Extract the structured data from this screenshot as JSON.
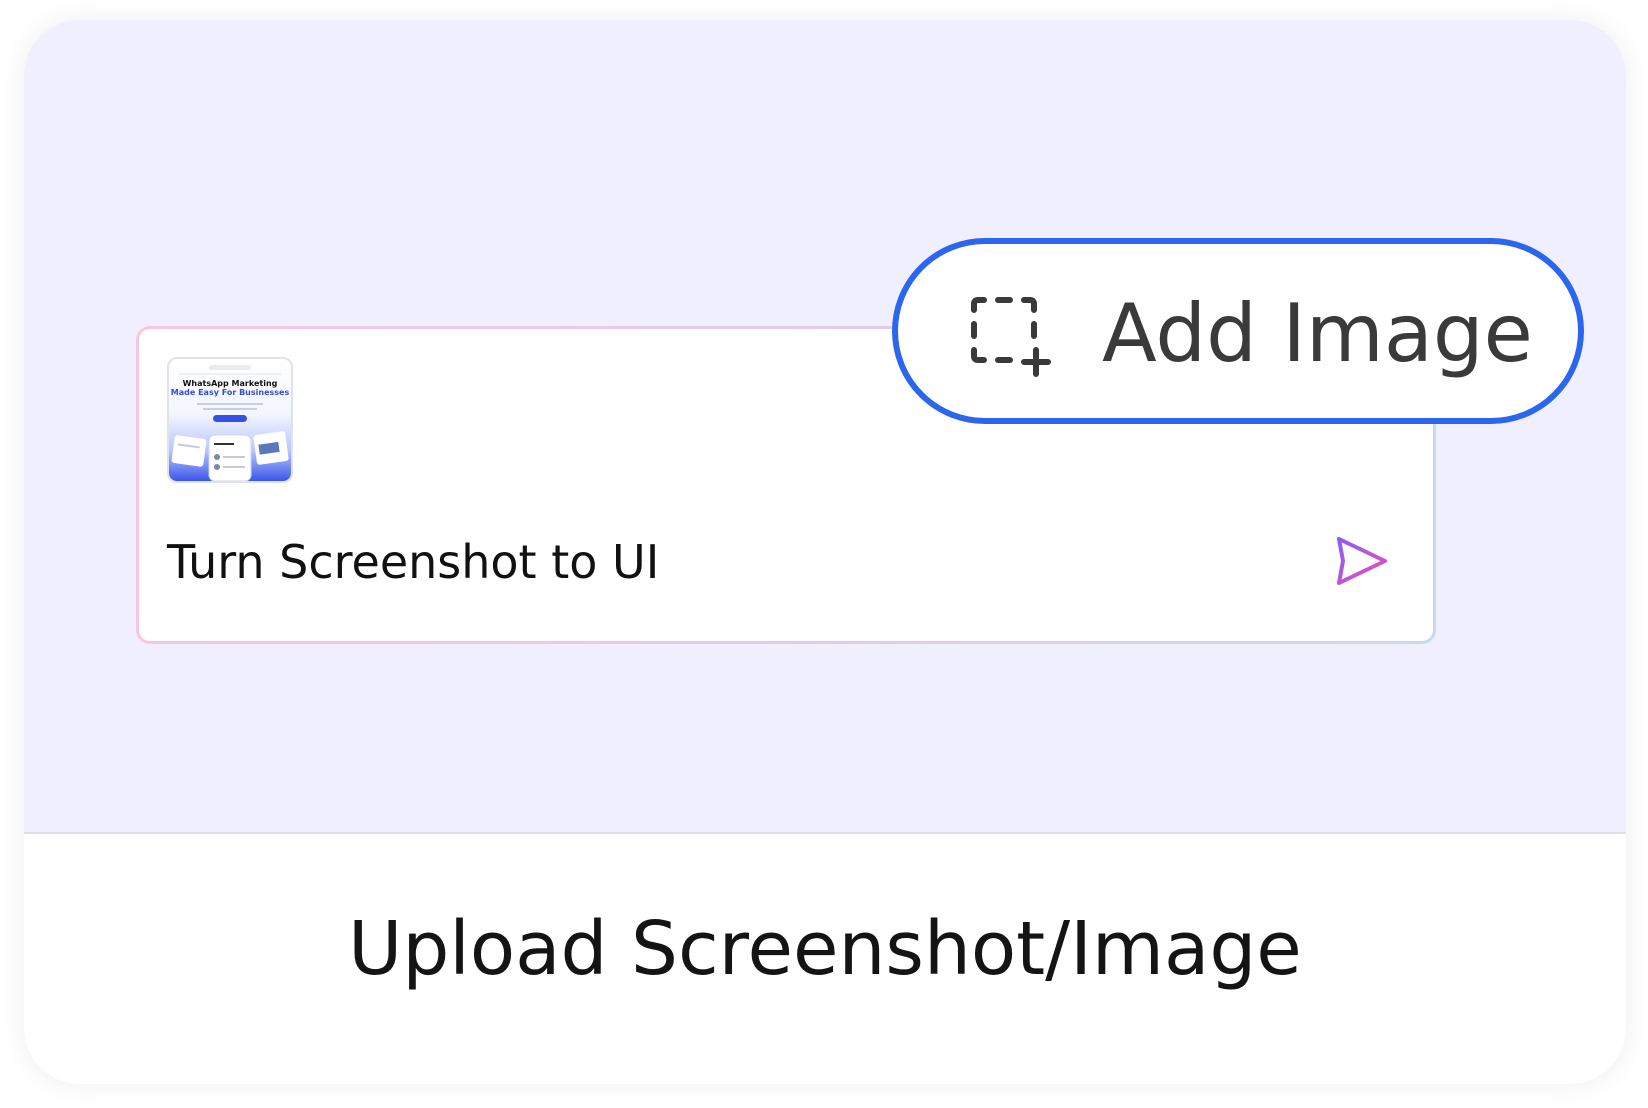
{
  "prompt": {
    "text": "Turn Screenshot to UI",
    "thumbnail": {
      "headline": "WhatsApp Marketing",
      "subheadline": "Made Easy For Businesses"
    },
    "send_icon": "send-icon"
  },
  "add_image": {
    "label": "Add Image",
    "icon": "image-add-icon"
  },
  "footer": {
    "title": "Upload Screenshot/Image"
  },
  "colors": {
    "hero_background": "#f0effd",
    "accent_blue": "#2b66ee",
    "send_gradient_start": "#8b5cf6",
    "send_gradient_end": "#ec4fb6"
  }
}
